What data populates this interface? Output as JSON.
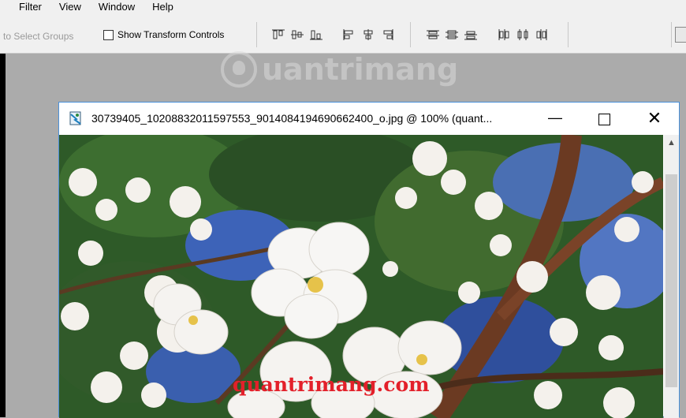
{
  "menu": {
    "items": [
      {
        "label": "Filter"
      },
      {
        "label": "View"
      },
      {
        "label": "Window"
      },
      {
        "label": "Help"
      }
    ]
  },
  "options_bar": {
    "auto_select_label": "to Select Groups",
    "show_transform_label": "Show Transform Controls",
    "show_transform_checked": false
  },
  "watermark": {
    "text": "uantrimang"
  },
  "document": {
    "title": "30739405_10208832011597553_9014084194690662400_o.jpg @ 100% (quant...",
    "min_glyph": "—",
    "close_glyph": "✕",
    "scroll_up_glyph": "▲"
  },
  "image_watermark": {
    "text": "quantrimang.com"
  },
  "colors": {
    "workspace": "#ababab",
    "toolbar": "#f0f0f0",
    "window_border": "#4a90d9",
    "watermark_red": "#e3202a"
  }
}
